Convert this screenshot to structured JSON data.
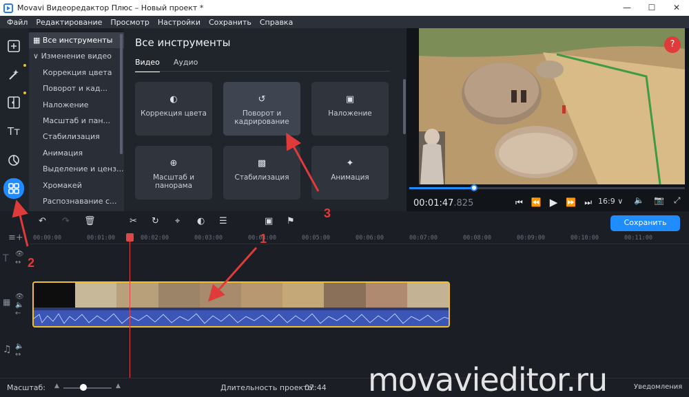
{
  "window": {
    "title": "Movavi Видеоредактор Плюс – Новый проект *"
  },
  "menu": [
    "Файл",
    "Редактирование",
    "Просмотр",
    "Настройки",
    "Сохранить",
    "Справка"
  ],
  "sidebar_icons": [
    "import-icon",
    "magic-filters-icon",
    "transitions-icon",
    "titles-icon",
    "stickers-icon",
    "all-tools-icon"
  ],
  "categories": {
    "selected": "Все инструменты",
    "group": "Изменение видео",
    "items": [
      "Коррекция цвета",
      "Поворот и кад...",
      "Наложение",
      "Масштаб и пан...",
      "Стабилизация",
      "Анимация",
      "Выделение и ценз...",
      "Хромакей",
      "Распознавание с..."
    ]
  },
  "panel": {
    "title": "Все инструменты",
    "tabs": [
      "Видео",
      "Аудио"
    ],
    "cards": [
      {
        "label": "Коррекция цвета",
        "icon": "color-correction-icon"
      },
      {
        "label": "Поворот и кадрирование",
        "icon": "rotate-crop-icon"
      },
      {
        "label": "Наложение",
        "icon": "overlay-icon"
      },
      {
        "label": "Масштаб и панорама",
        "icon": "zoom-pan-icon"
      },
      {
        "label": "Стабилизация",
        "icon": "stabilization-icon"
      },
      {
        "label": "Анимация",
        "icon": "animation-icon"
      }
    ]
  },
  "preview": {
    "help": "?",
    "time_main": "00:01:47",
    "time_ms": ".825",
    "progress": 0.236,
    "aspect": "16:9"
  },
  "toolbar": {
    "save_label": "Сохранить"
  },
  "ruler": [
    "00:00:00",
    "00:01:00",
    "00:02:00",
    "00:03:00",
    "00:04:00",
    "00:05:00",
    "00:06:00",
    "00:07:00",
    "00:08:00",
    "00:09:00",
    "00:10:00",
    "00:11:00"
  ],
  "status": {
    "scale_label": "Масштаб:",
    "duration_label": "Длительность проекта:",
    "duration_value": "07:44",
    "notifications": "Уведомления"
  },
  "watermark": "movavieditor.ru",
  "annotations": [
    "1",
    "2",
    "3"
  ],
  "colors": {
    "accent": "#1f8cff",
    "annotation": "#e03b3b",
    "clip_border": "#f0c030"
  }
}
